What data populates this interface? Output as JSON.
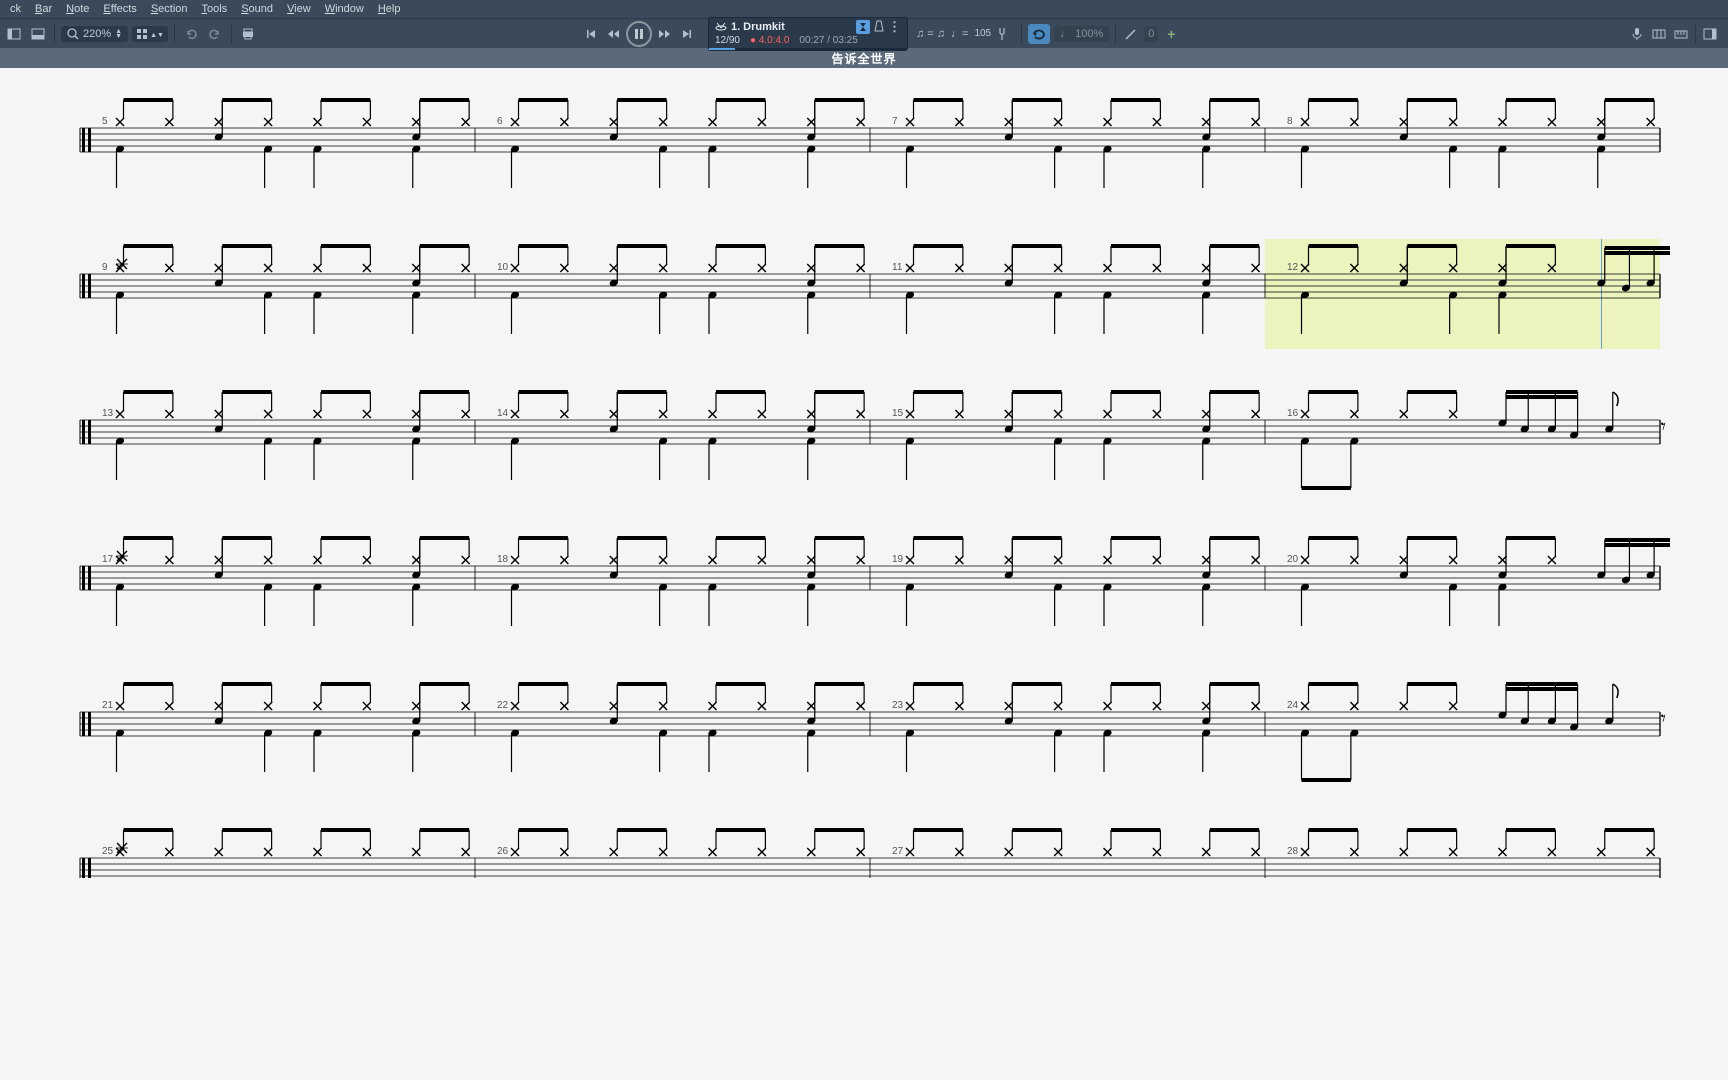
{
  "menu": [
    "ck",
    "Bar",
    "Note",
    "Effects",
    "Section",
    "Tools",
    "Sound",
    "View",
    "Window",
    "Help"
  ],
  "zoom": "220%",
  "track": {
    "name": "1. Drumkit",
    "bar": "12/90",
    "rec": "4.0:4.0",
    "time": "00:27 / 03:25",
    "tempo": "105",
    "speed": "100%",
    "speed_incr": "0"
  },
  "title": "告诉全世界",
  "staffLines": [
    {
      "bars": [
        5,
        6,
        7,
        8
      ],
      "highlight": null,
      "special": "normal"
    },
    {
      "bars": [
        9,
        10,
        11,
        12
      ],
      "highlight": 3,
      "playhead": 3.85,
      "special": "bar4fill"
    },
    {
      "bars": [
        13,
        14,
        15,
        16
      ],
      "highlight": null,
      "special": "bar4short"
    },
    {
      "bars": [
        17,
        18,
        19,
        20
      ],
      "highlight": null,
      "special": "bar4fill2"
    },
    {
      "bars": [
        21,
        22,
        23,
        24
      ],
      "highlight": null,
      "special": "bar4short"
    },
    {
      "bars": [
        25,
        26,
        27,
        28
      ],
      "highlight": null,
      "special": "partial"
    }
  ]
}
